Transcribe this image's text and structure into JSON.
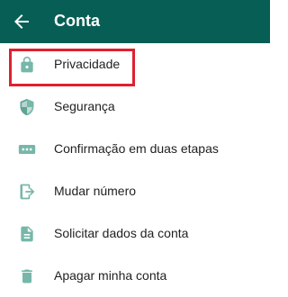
{
  "header": {
    "title": "Conta",
    "back_icon": "arrow-left-icon",
    "background_color": "#075e54"
  },
  "menu": {
    "icon_color": "#76b7a9",
    "items": [
      {
        "label": "Privacidade",
        "icon": "lock-icon"
      },
      {
        "label": "Segurança",
        "icon": "shield-icon"
      },
      {
        "label": "Confirmação em duas etapas",
        "icon": "dots-icon"
      },
      {
        "label": "Mudar número",
        "icon": "change-number-icon"
      },
      {
        "label": "Solicitar dados da conta",
        "icon": "document-icon"
      },
      {
        "label": "Apagar minha conta",
        "icon": "trash-icon"
      }
    ]
  },
  "highlight": {
    "target": "Privacidade",
    "color": "#e0202f"
  }
}
